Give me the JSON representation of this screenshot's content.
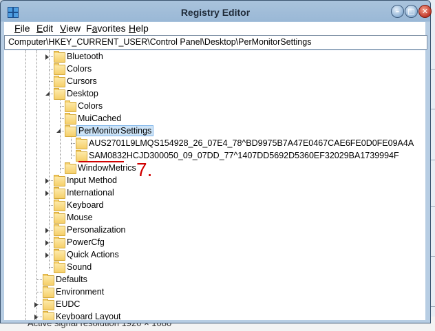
{
  "window": {
    "title": "Registry Editor",
    "buttons": {
      "minimize": "–",
      "maximize": "□",
      "close": "✕"
    }
  },
  "menu": {
    "items": [
      {
        "pre": "",
        "u": "F",
        "post": "ile"
      },
      {
        "pre": "",
        "u": "E",
        "post": "dit"
      },
      {
        "pre": "",
        "u": "V",
        "post": "iew"
      },
      {
        "pre": "F",
        "u": "a",
        "post": "vorites"
      },
      {
        "pre": "",
        "u": "H",
        "post": "elp"
      }
    ]
  },
  "address": "Computer\\HKEY_CURRENT_USER\\Control Panel\\Desktop\\PerMonitorSettings",
  "tree": {
    "nodes": [
      {
        "label": "Bluetooth",
        "state": "collapsed"
      },
      {
        "label": "Colors",
        "state": "none"
      },
      {
        "label": "Cursors",
        "state": "none"
      },
      {
        "label": "Desktop",
        "state": "expanded"
      },
      {
        "label": "Colors",
        "state": "none"
      },
      {
        "label": "MuiCached",
        "state": "none"
      },
      {
        "label": "PerMonitorSettings",
        "state": "expanded",
        "selected": true
      },
      {
        "label": "AUS2701L9LMQS154928_26_07E4_78^BD9975B7A47E0467CAE6FE0D0FE09A4A",
        "state": "none"
      },
      {
        "label": "SAM0832HCJD300050_09_07DD_77^1407DD5692D5360EF32029BA1739994F",
        "state": "none"
      },
      {
        "label": "WindowMetrics",
        "state": "none"
      },
      {
        "label": "Input Method",
        "state": "collapsed"
      },
      {
        "label": "International",
        "state": "collapsed"
      },
      {
        "label": "Keyboard",
        "state": "none"
      },
      {
        "label": "Mouse",
        "state": "none"
      },
      {
        "label": "Personalization",
        "state": "collapsed"
      },
      {
        "label": "PowerCfg",
        "state": "collapsed"
      },
      {
        "label": "Quick Actions",
        "state": "collapsed"
      },
      {
        "label": "Sound",
        "state": "none"
      },
      {
        "label": "Defaults",
        "state": "none"
      },
      {
        "label": "Environment",
        "state": "none"
      },
      {
        "label": "EUDC",
        "state": "collapsed"
      },
      {
        "label": "Keyboard Layout",
        "state": "collapsed"
      }
    ]
  },
  "annotation": {
    "number": "7."
  },
  "background": {
    "bottom_text": "Active signal resolution 1920 × 1080"
  },
  "colors": {
    "annotation": "#d00000",
    "selection": "#cce3f7",
    "folder": "#f5cf6a"
  }
}
